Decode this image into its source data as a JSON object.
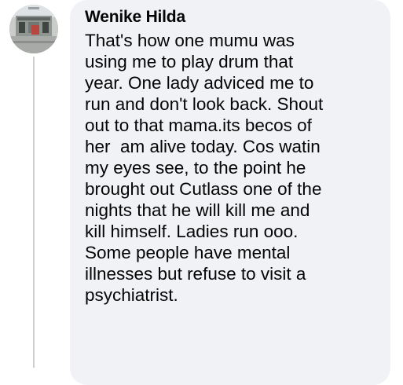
{
  "comment": {
    "author": "Wenike Hilda",
    "lines": [
      "That's how one mumu was",
      "using me to play drum that",
      "year. One lady adviced me to",
      "run and don't look back. Shout",
      "out to that mama.its becos of",
      "her  am alive today. Cos watin",
      "my eyes see, to the point he",
      "brought out Cutlass one of the",
      "nights that he will kill me and",
      "kill himself. Ladies run ooo.",
      "Some people have mental",
      "illnesses but refuse to visit a",
      "psychiatrist."
    ]
  },
  "colors": {
    "bubble_background": "#f0f2f5",
    "text": "#050505",
    "thread_line": "#ced0d4"
  },
  "icons": {
    "avatar": "profile-photo"
  }
}
